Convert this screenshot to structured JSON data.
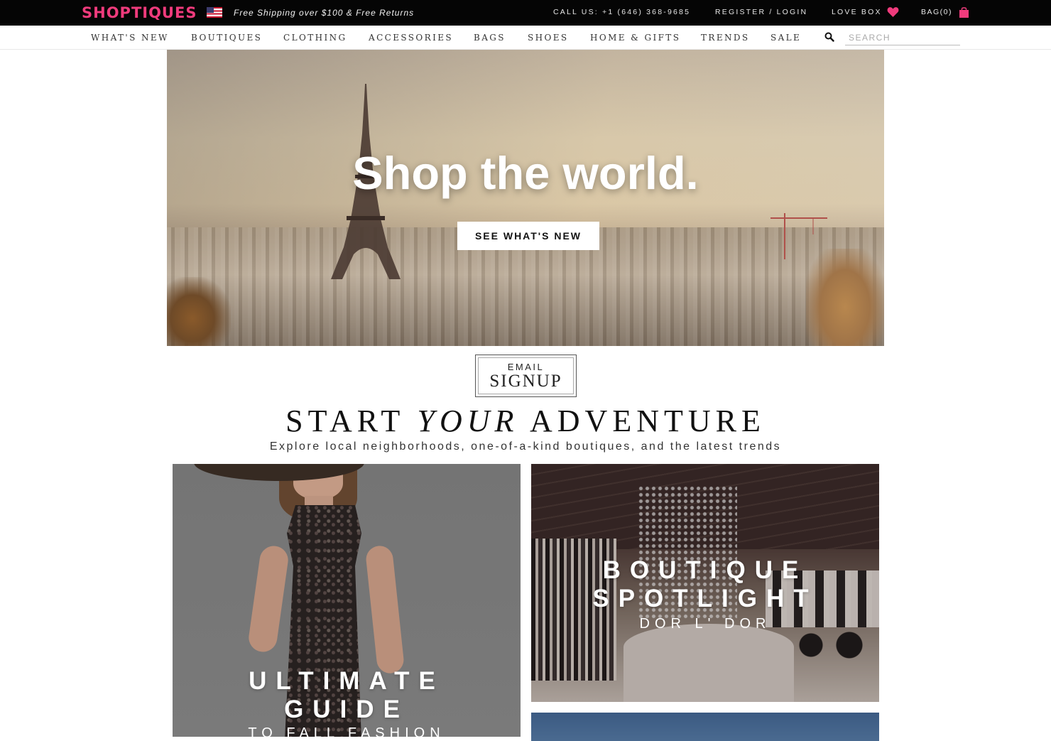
{
  "topbar": {
    "logo": "SHOPTIQUES",
    "shipping": "Free Shipping over $100 & Free Returns",
    "call": "CALL US: +1 (646) 368-9685",
    "register": "REGISTER / LOGIN",
    "lovebox": "LOVE BOX",
    "bag": "BAG(0)",
    "brand_color": "#ef3b7c"
  },
  "nav": {
    "items": [
      "WHAT'S NEW",
      "BOUTIQUES",
      "CLOTHING",
      "ACCESSORIES",
      "BAGS",
      "SHOES",
      "HOME & GIFTS",
      "TRENDS",
      "SALE"
    ],
    "search_placeholder": "SEARCH"
  },
  "hero": {
    "title": "Shop the world.",
    "button": "SEE WHAT'S NEW"
  },
  "signup": {
    "top": "EMAIL",
    "bottom": "SIGNUP"
  },
  "adventure": {
    "title_start": "START ",
    "title_em": "YOUR",
    "title_end": " ADVENTURE",
    "subtitle": "Explore local neighborhoods, one-of-a-kind boutiques, and the latest trends"
  },
  "tiles": {
    "guide": {
      "line1": "ULTIMATE",
      "line2": "GUIDE",
      "sub": "TO FALL FASHION"
    },
    "spotlight": {
      "line1": "BOUTIQUE",
      "line2": "SPOTLIGHT",
      "sub": "DOR L' DOR"
    }
  }
}
